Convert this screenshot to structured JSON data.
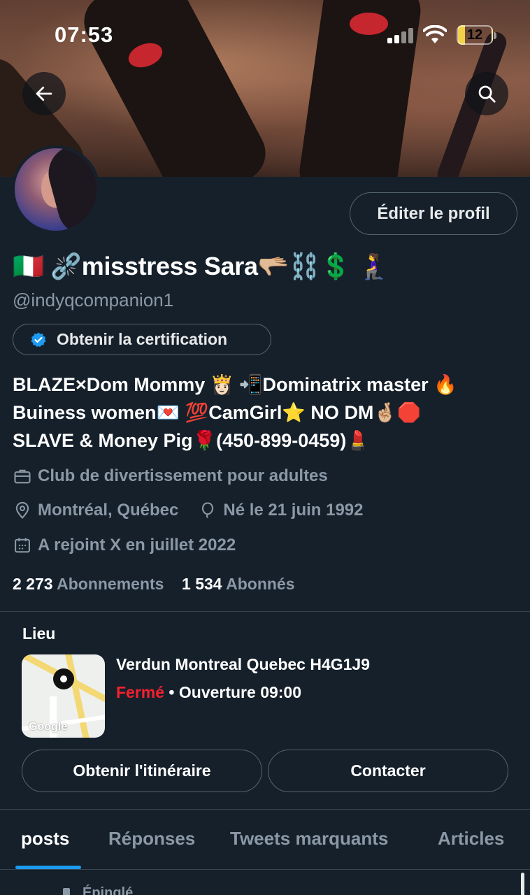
{
  "status_bar": {
    "time": "07:53",
    "battery": "12"
  },
  "header": {
    "back_icon": "arrow-left-icon",
    "search_icon": "search-icon"
  },
  "profile": {
    "edit_button": "Éditer le profil",
    "display_name": "🇮🇹 ⛓️‍💥misstress Sara🫳🏼⛓️💲 🧎‍♀️",
    "handle": "@indyqcompanion1",
    "certification_button": "Obtenir la certification",
    "bio_lines": [
      "BLAZE×Dom Mommy 👸🏻 📲Dominatrix master 🔥",
      "Buiness women💌 💯CamGirl⭐ NO DM🤞🏼🛑",
      "SLAVE & Money Pig🌹(450-899-0459)💄"
    ],
    "category": "Club de divertissement pour adultes",
    "location": "Montréal, Québec",
    "birthday": "Né le 21 juin 1992",
    "joined": "A rejoint X en juillet 2022",
    "following_count": "2 273",
    "following_label": "Abonnements",
    "followers_count": "1 534",
    "followers_label": "Abonnés"
  },
  "location_card": {
    "title": "Lieu",
    "address": "Verdun Montreal Quebec H4G1J9",
    "status": "Fermé",
    "hours": " • Ouverture 09:00",
    "map_watermark": "Google",
    "directions_button": "Obtenir l'itinéraire",
    "contact_button": "Contacter"
  },
  "tabs": [
    {
      "label": "posts",
      "active": true
    },
    {
      "label": "Réponses",
      "active": false
    },
    {
      "label": "Tweets marquants",
      "active": false
    },
    {
      "label": "Articles",
      "active": false
    }
  ],
  "pinned_label": "Épinglé",
  "colors": {
    "background": "#15202b",
    "accent": "#1d9bf0",
    "closed": "#f4212e",
    "muted": "#8b98a5"
  }
}
